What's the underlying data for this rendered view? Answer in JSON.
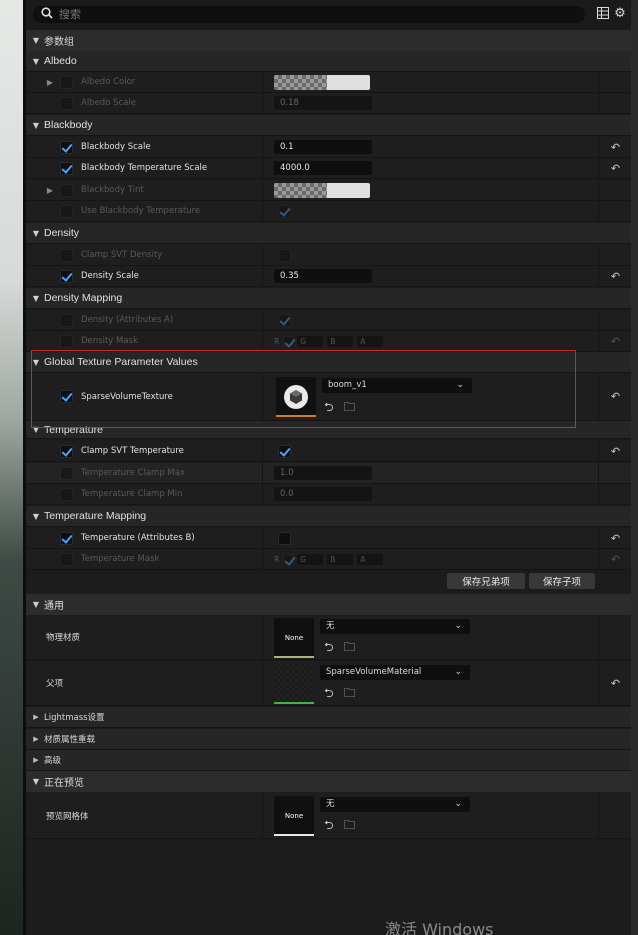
{
  "search": {
    "placeholder": "搜索"
  },
  "sections": {
    "param_group": "参数组",
    "general": "通用",
    "previewing": "正在预览"
  },
  "groups": {
    "albedo": "Albedo",
    "blackbody": "Blackbody",
    "density": "Density",
    "density_mapping": "Density Mapping",
    "global_texture": "Global Texture Parameter Values",
    "temperature": "Temperature",
    "temperature_mapping": "Temperature Mapping"
  },
  "props": {
    "albedo_color": "Albedo Color",
    "albedo_scale": "Albedo Scale",
    "albedo_scale_value": "0.18",
    "bb_scale": "Blackbody Scale",
    "bb_scale_value": "0.1",
    "bb_temp_scale": "Blackbody Temperature Scale",
    "bb_temp_scale_value": "4000.0",
    "bb_tint": "Blackbody Tint",
    "use_bb_temp": "Use Blackbody Temperature",
    "clamp_svt_density": "Clamp SVT Density",
    "density_scale": "Density Scale",
    "density_scale_value": "0.35",
    "density_attr": "Density (Attributes A)",
    "density_mask": "Density Mask",
    "sparse_volume_texture": "SparseVolumeTexture",
    "sparse_volume_texture_value": "boom_v1",
    "clamp_svt_temp": "Clamp SVT Temperature",
    "temp_clamp_max": "Temperature Clamp Max",
    "temp_clamp_max_value": "1.0",
    "temp_clamp_min": "Temperature Clamp Min",
    "temp_clamp_min_value": "0.0",
    "temp_attr": "Temperature (Attributes B)",
    "temp_mask": "Temperature Mask"
  },
  "mask_channels": [
    "R",
    "G",
    "B",
    "A"
  ],
  "buttons": {
    "save_siblings": "保存兄弟项",
    "save_children": "保存子项"
  },
  "general": {
    "phys_material_label": "物理材质",
    "phys_material_thumb": "None",
    "phys_material_value": "无",
    "parent_label": "父项",
    "parent_value": "SparseVolumeMaterial",
    "lightmass": "Lightmass设置",
    "material_overrides": "材质属性重载",
    "advanced": "高级"
  },
  "preview": {
    "preview_mesh_label": "预览网格体",
    "preview_mesh_thumb": "None",
    "preview_mesh_value": "无"
  },
  "watermark": "激活 Windows",
  "colors": {
    "highlight": "#d0282d",
    "checkbox_accent": "#4aa3ff",
    "panel": "#1c1c1c"
  },
  "icons": [
    "search-icon",
    "grid-icon",
    "gear-icon",
    "reset-arrow-icon",
    "browse-arrow-icon",
    "folder-search-icon",
    "chevron-down-icon"
  ]
}
